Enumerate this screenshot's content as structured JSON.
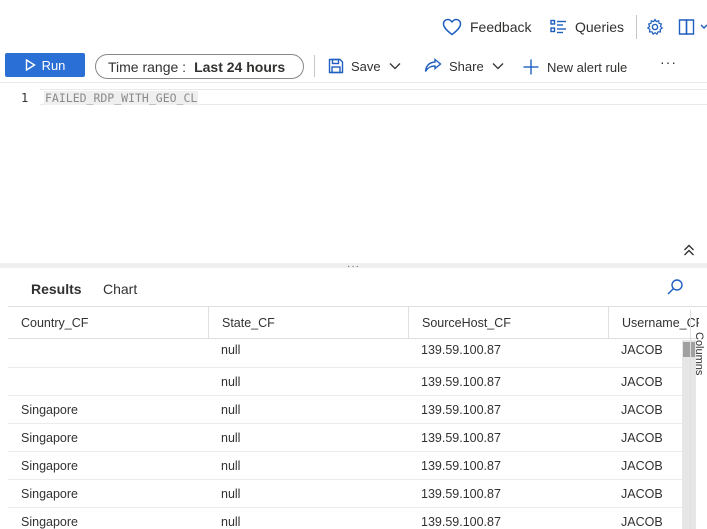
{
  "topbar": {
    "feedback_label": "Feedback",
    "queries_label": "Queries"
  },
  "toolbar": {
    "run_label": "Run",
    "time_range_label": "Time range :",
    "time_range_value": "Last 24 hours",
    "save_label": "Save",
    "share_label": "Share",
    "new_alert_label": "New alert rule",
    "more_label": "···"
  },
  "editor": {
    "line_number": "1",
    "code": "FAILED_RDP_WITH_GEO_CL"
  },
  "results": {
    "tabs": [
      {
        "label": "Results"
      },
      {
        "label": "Chart"
      }
    ],
    "columns": [
      "Country_CF",
      "State_CF",
      "SourceHost_CF",
      "Username_CF"
    ],
    "rows": [
      {
        "country": "",
        "state": "null",
        "source_host": "139.59.100.87",
        "username": "JACOB"
      },
      {
        "country": "",
        "state": "null",
        "source_host": "139.59.100.87",
        "username": "JACOB"
      },
      {
        "country": "Singapore",
        "state": "null",
        "source_host": "139.59.100.87",
        "username": "JACOB"
      },
      {
        "country": "Singapore",
        "state": "null",
        "source_host": "139.59.100.87",
        "username": "JACOB"
      },
      {
        "country": "Singapore",
        "state": "null",
        "source_host": "139.59.100.87",
        "username": "JACOB"
      },
      {
        "country": "Singapore",
        "state": "null",
        "source_host": "139.59.100.87",
        "username": "JACOB"
      },
      {
        "country": "Singapore",
        "state": "null",
        "source_host": "139.59.100.87",
        "username": "JACOB"
      }
    ],
    "side_panel_label": "Columns"
  },
  "colors": {
    "accent": "#2a6fd6",
    "icon_blue": "#1f5fbf"
  },
  "icons": [
    "heart-icon",
    "list-icon",
    "gear-icon",
    "book-icon",
    "play-icon",
    "save-icon",
    "share-icon",
    "plus-icon",
    "chevron-down-icon",
    "double-chevron-up-icon",
    "search-icon"
  ]
}
